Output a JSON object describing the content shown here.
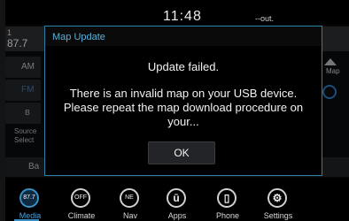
{
  "status_bar": {
    "time": "11:48",
    "temperature": "--out."
  },
  "background": {
    "preset_number": "1",
    "preset_frequency": "87.7",
    "buttons": {
      "am": "AM",
      "fm": "FM"
    },
    "source_select": "Source\nSelect",
    "bottom_label": "Ba",
    "map_label": "Map"
  },
  "dialog": {
    "title": "Map Update",
    "heading": "Update failed.",
    "message": "There is an invalid map on your USB device. Please repeat the map download procedure on your...",
    "ok_label": "OK"
  },
  "nav": {
    "items": [
      {
        "label": "Media",
        "icon_text": "87.7",
        "icon": "radio-icon",
        "active": true
      },
      {
        "label": "Climate",
        "icon_text": "OFF",
        "icon": "climate-icon"
      },
      {
        "label": "Nav",
        "icon_text": "NE",
        "icon": "compass-icon"
      },
      {
        "label": "Apps",
        "icon_text": "ū",
        "icon": "apps-icon"
      },
      {
        "label": "Phone",
        "icon_text": "▯",
        "icon": "phone-icon"
      },
      {
        "label": "Settings",
        "icon_text": "⚙",
        "icon": "gear-icon"
      }
    ]
  },
  "colors": {
    "accent": "#3a8fc4",
    "dialog_border": "#2a7fa3",
    "title": "#5ab0d8"
  }
}
